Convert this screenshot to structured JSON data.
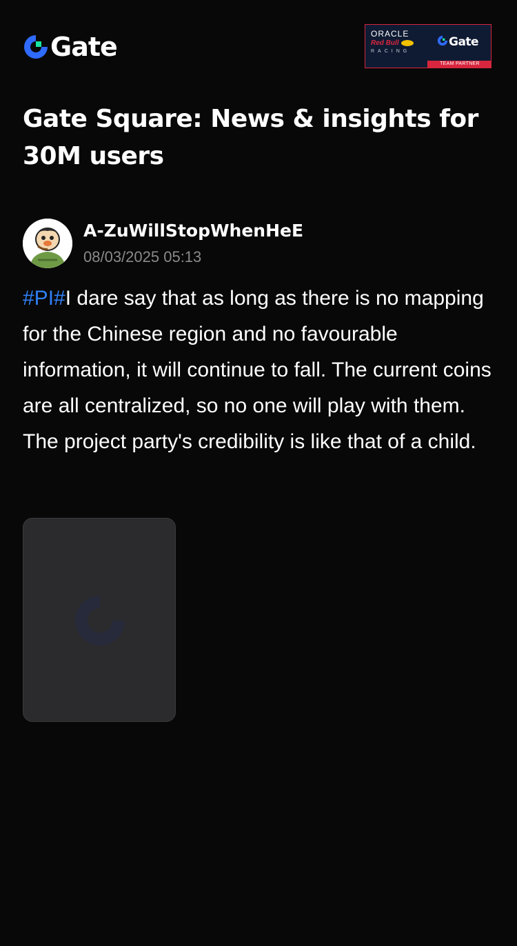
{
  "header": {
    "brand_name": "Gate",
    "logo_icon": "gate-logo-icon",
    "partner": {
      "oracle": "ORACLE",
      "red_bull": "Red Bull",
      "racing": "RACING",
      "brand_name": "Gate",
      "team_partner": "TEAM PARTNER"
    }
  },
  "page": {
    "title": "Gate Square: News & insights for 30M users"
  },
  "post": {
    "author": {
      "name": "A-ZuWillStopWhenHeE",
      "avatar_icon": "cartoon-avatar"
    },
    "timestamp": "08/03/2025 05:13",
    "hashtag": "#PI#",
    "body": "I dare say that as long as there is no mapping for the Chinese region and no favourable information, it will continue to fall. The current coins are all centralized, so no one will play with them. The project party's credibility is like that of a child.",
    "image_placeholder_icon": "gate-logo-placeholder-icon"
  },
  "colors": {
    "background": "#080808",
    "accent_blue": "#2f80f5",
    "logo_green": "#17e6a1",
    "muted_text": "#8a8a8a",
    "card_background": "#2b2b2d",
    "partner_red": "#d7263d",
    "partner_navy": "#0f1b33"
  }
}
